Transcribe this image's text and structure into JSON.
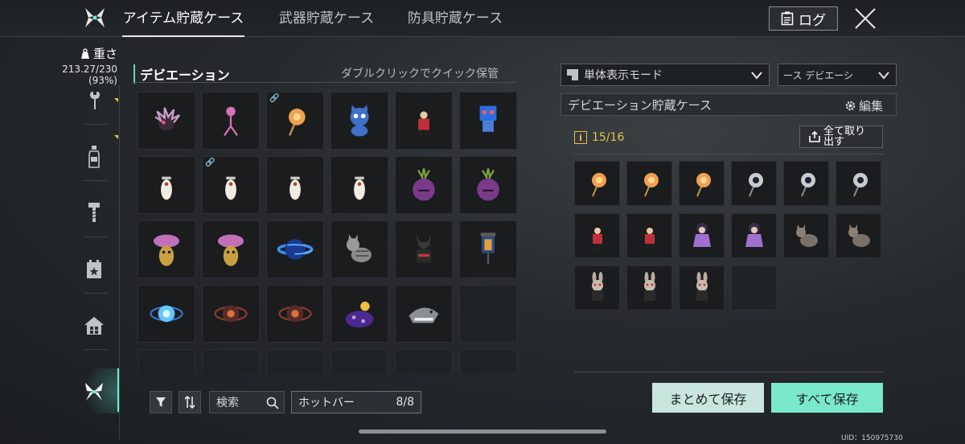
{
  "header": {
    "tabs": [
      {
        "label": "アイテム貯蔵ケース",
        "active": true
      },
      {
        "label": "武器貯蔵ケース",
        "active": false
      },
      {
        "label": "防具貯蔵ケース",
        "active": false
      }
    ],
    "log_label": "ログ"
  },
  "sidebar": {
    "weight_label": "重さ",
    "weight_value": "213.27/230",
    "weight_percent": "(93%)",
    "icons": [
      "wrench-icon",
      "bottle-icon",
      "bolt-icon",
      "calendar-star-icon",
      "house-icon",
      "butterfly-icon"
    ],
    "active_icon": "butterfly-icon"
  },
  "inventory": {
    "title": "デビエーション",
    "hint": "ダブルクリックでクイック保管",
    "search_label": "検索",
    "hotbar_label": "ホットバー",
    "hotbar_count": "8/8",
    "items": [
      {
        "icon": "spiky-creature"
      },
      {
        "icon": "pink-stick-figure"
      },
      {
        "icon": "orange-orb-staff",
        "linked": true
      },
      {
        "icon": "blue-cat-plush"
      },
      {
        "icon": "nutcracker-soldier"
      },
      {
        "icon": "blue-robot-figure"
      },
      {
        "icon": "penguin-figure"
      },
      {
        "icon": "penguin-figure",
        "linked": true
      },
      {
        "icon": "penguin-figure"
      },
      {
        "icon": "penguin-figure"
      },
      {
        "icon": "onion-creature"
      },
      {
        "icon": "onion-creature"
      },
      {
        "icon": "mushroom-figure"
      },
      {
        "icon": "mushroom-figure"
      },
      {
        "icon": "blue-planet"
      },
      {
        "icon": "tabby-cat"
      },
      {
        "icon": "dark-dog-figure"
      },
      {
        "icon": "lantern-box"
      },
      {
        "icon": "blue-energy-orb"
      },
      {
        "icon": "red-eye-orb"
      },
      {
        "icon": "red-eye-orb"
      },
      {
        "icon": "purple-creature"
      },
      {
        "icon": "shark-figure"
      },
      {
        "icon": "empty"
      }
    ]
  },
  "storage": {
    "view_mode": "単体表示モード",
    "filter": "ース デビエーシ",
    "title": "デビエーション貯蔵ケース",
    "edit_label": "編集",
    "capacity": "15/16",
    "take_all_label": "全て取り出す",
    "items": [
      {
        "icon": "orange-orb-staff"
      },
      {
        "icon": "orange-orb-staff"
      },
      {
        "icon": "orange-orb-staff"
      },
      {
        "icon": "silver-orb-staff"
      },
      {
        "icon": "silver-orb-staff"
      },
      {
        "icon": "silver-orb-staff"
      },
      {
        "icon": "nutcracker-soldier"
      },
      {
        "icon": "nutcracker-soldier"
      },
      {
        "icon": "purple-doll"
      },
      {
        "icon": "purple-doll"
      },
      {
        "icon": "gray-cat"
      },
      {
        "icon": "gray-cat"
      },
      {
        "icon": "bunny-figure"
      },
      {
        "icon": "bunny-figure"
      },
      {
        "icon": "bunny-figure"
      },
      {
        "icon": "empty"
      }
    ]
  },
  "actions": {
    "save_bulk": "まとめて保存",
    "save_all": "すべて保存"
  },
  "footer": {
    "uid": "UID：150975730"
  },
  "colors": {
    "accent": "#6ef0d8",
    "button_light": "#c8e6de",
    "button_mint": "#7ae8cc",
    "capacity": "#e8c240"
  }
}
